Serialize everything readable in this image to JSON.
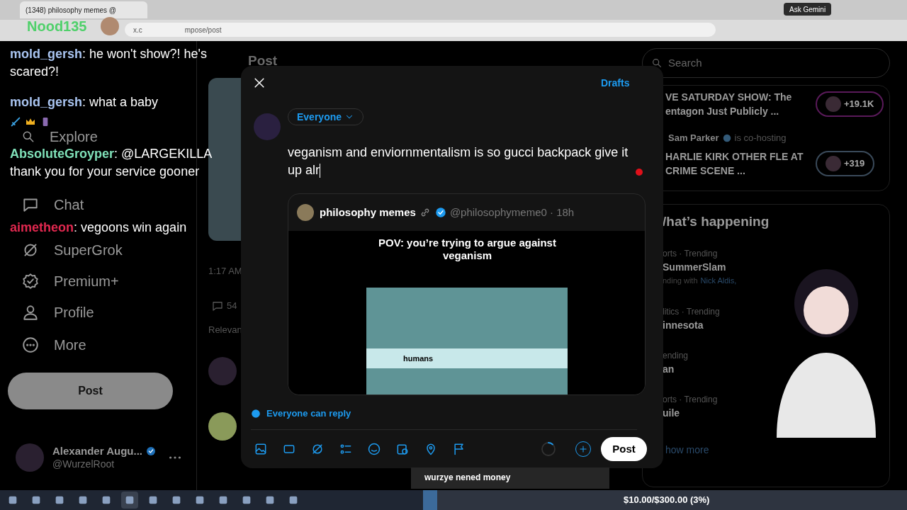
{
  "browser": {
    "tab_title": "(1348) philosophy memes @",
    "address": "x.c",
    "address_end": "mpose/post",
    "ask_button": "Ask Gemini"
  },
  "stream_overlay": {
    "viewer_name": "Nood135",
    "chat": [
      {
        "user": "mold_gersh",
        "color": "#a9c4f0",
        "text": ": he won't show?! he's scared?!"
      },
      {
        "user": "mold_gersh",
        "color": "#a9c4f0",
        "text": ": what a baby"
      },
      {
        "user": "AbsoluteGroyper",
        "color": "#7fe0b8",
        "text": ": @LARGEKILLA thank you for your service gooner"
      },
      {
        "user": "aimetheon",
        "color": "#e0284f",
        "text": ": vegoons win again"
      }
    ]
  },
  "sidebar": {
    "items": [
      {
        "label": "Explore"
      },
      {
        "label": "Chat"
      },
      {
        "label": "SuperGrok"
      },
      {
        "label": "Premium+"
      },
      {
        "label": "Profile"
      },
      {
        "label": "More"
      }
    ],
    "post_button": "Post",
    "account": {
      "name": "Alexander Augu...",
      "handle": "@WurzelRoot"
    }
  },
  "main": {
    "title": "Post",
    "time": "1:17 AM",
    "reply_count": "54",
    "sort": "Relevan"
  },
  "compose": {
    "drafts": "Drafts",
    "audience": "Everyone",
    "text": "veganism and enviornmentalism is so gucci backpack give it up alr",
    "quote": {
      "name": "philosophy memes",
      "handle": "@philosophymeme0 · 18h",
      "caption": "POV: you’re trying to argue against veganism",
      "image_label": "humans"
    },
    "reply_setting": "Everyone can reply",
    "post_button": "Post"
  },
  "right": {
    "search": {
      "placeholder": "Search"
    },
    "spaces": [
      {
        "title": "VE SATURDAY SHOW: The entagon Just Publicly ...",
        "count": "+19.1K"
      },
      {
        "host": "Sam Parker",
        "host_note": "is co-hosting",
        "title": "HARLIE KIRK OTHER FLE AT CRIME SCENE ...",
        "count": "+319"
      }
    ],
    "trends_title": "/hat’s happening",
    "trends": [
      {
        "category": "orts · Trending",
        "title": "SummerSlam",
        "extra": "nding with",
        "link": "Nick Aldis,"
      },
      {
        "category": "litics · Trending",
        "title": "innesota"
      },
      {
        "category": "ending",
        "title": "an"
      },
      {
        "category": "orts · Trending",
        "title": "uile"
      }
    ],
    "show_more": "how more"
  },
  "donation": {
    "message": "wurzye nened money",
    "goal": "$10.00/$300.00 (3%)",
    "level": 0.03
  }
}
